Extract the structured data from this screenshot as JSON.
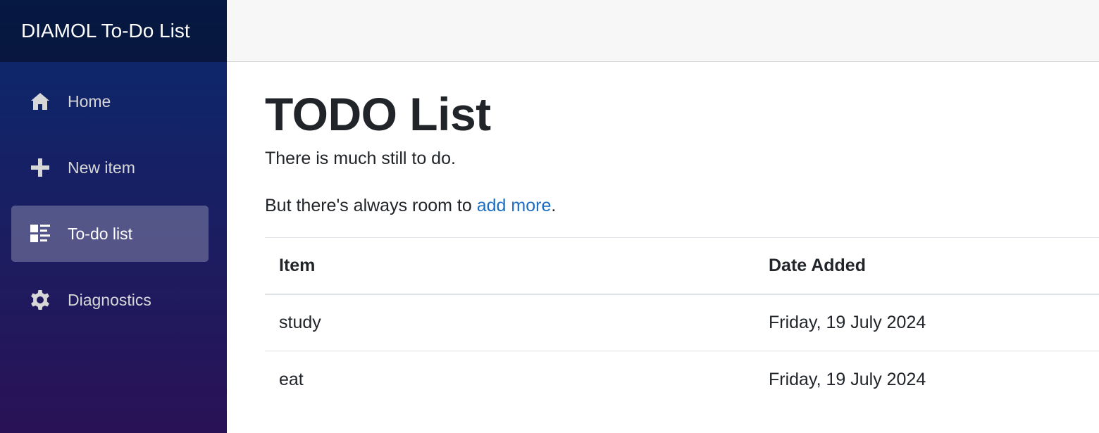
{
  "brand": {
    "title": "DIAMOL To-Do List"
  },
  "sidebar": {
    "items": [
      {
        "label": "Home",
        "icon": "home-icon",
        "active": false
      },
      {
        "label": "New item",
        "icon": "plus-icon",
        "active": false
      },
      {
        "label": "To-do list",
        "icon": "list-icon",
        "active": true
      },
      {
        "label": "Diagnostics",
        "icon": "gear-icon",
        "active": false
      }
    ]
  },
  "main": {
    "title": "TODO List",
    "intro": "There is much still to do.",
    "room_prefix": "But there's always room to ",
    "room_link": "add more",
    "room_suffix": "."
  },
  "table": {
    "headers": [
      "Item",
      "Date Added"
    ],
    "rows": [
      [
        "study",
        "Friday, 19 July 2024"
      ],
      [
        "eat",
        "Friday, 19 July 2024"
      ]
    ]
  },
  "colors": {
    "sidebar_gradient_top": "#0a2a6e",
    "sidebar_gradient_bottom": "#2a1256",
    "link": "#1b6ec2",
    "text": "#212529"
  }
}
